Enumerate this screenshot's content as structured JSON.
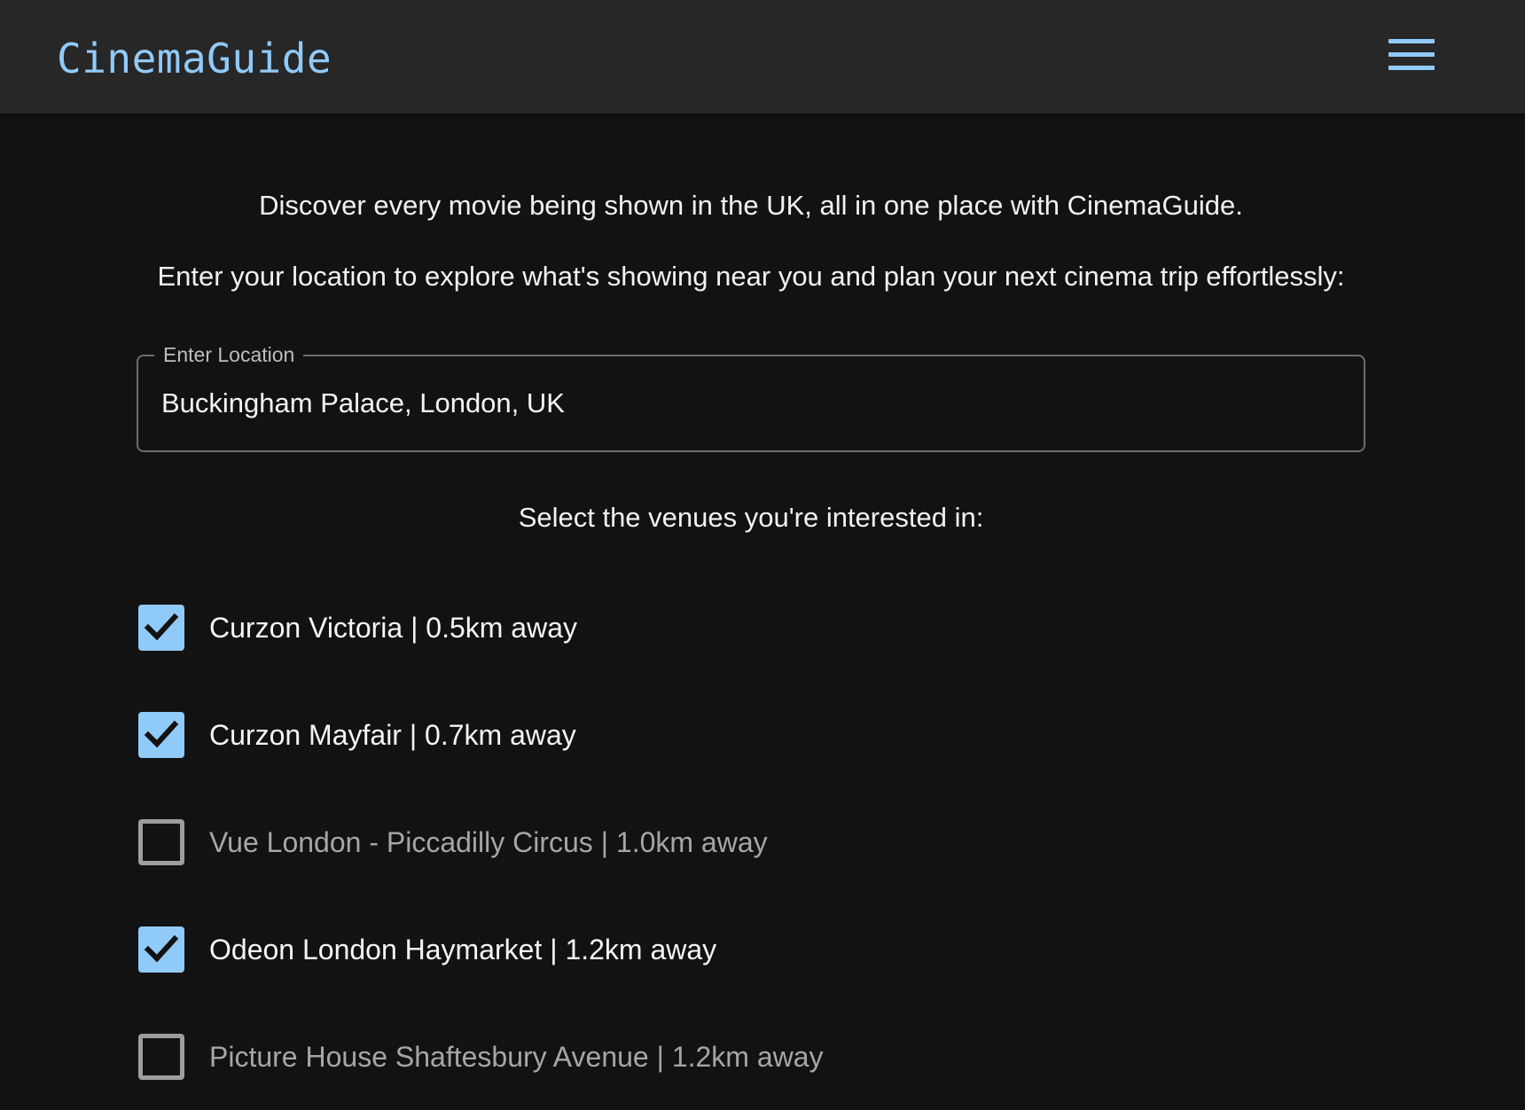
{
  "app": {
    "title": "CinemaGuide",
    "menu_icon": "hamburger-menu-icon"
  },
  "intro": {
    "line1": "Discover every movie being shown in the UK, all in one place with CinemaGuide.",
    "line2": "Enter your location to explore what's showing near you and plan your next cinema trip effortlessly:"
  },
  "location": {
    "label": "Enter Location",
    "value": "Buckingham Palace, London, UK"
  },
  "venues_heading": "Select the venues you're interested in:",
  "venues": [
    {
      "label": "Curzon Victoria | 0.5km away",
      "checked": true
    },
    {
      "label": "Curzon Mayfair | 0.7km away",
      "checked": true
    },
    {
      "label": "Vue London - Piccadilly Circus | 1.0km away",
      "checked": false
    },
    {
      "label": "Odeon London Haymarket | 1.2km away",
      "checked": true
    },
    {
      "label": "Picture House Shaftesbury Avenue | 1.2km away",
      "checked": false
    }
  ],
  "colors": {
    "accent": "#90caf9",
    "background": "#121212",
    "appbar": "#272727"
  }
}
